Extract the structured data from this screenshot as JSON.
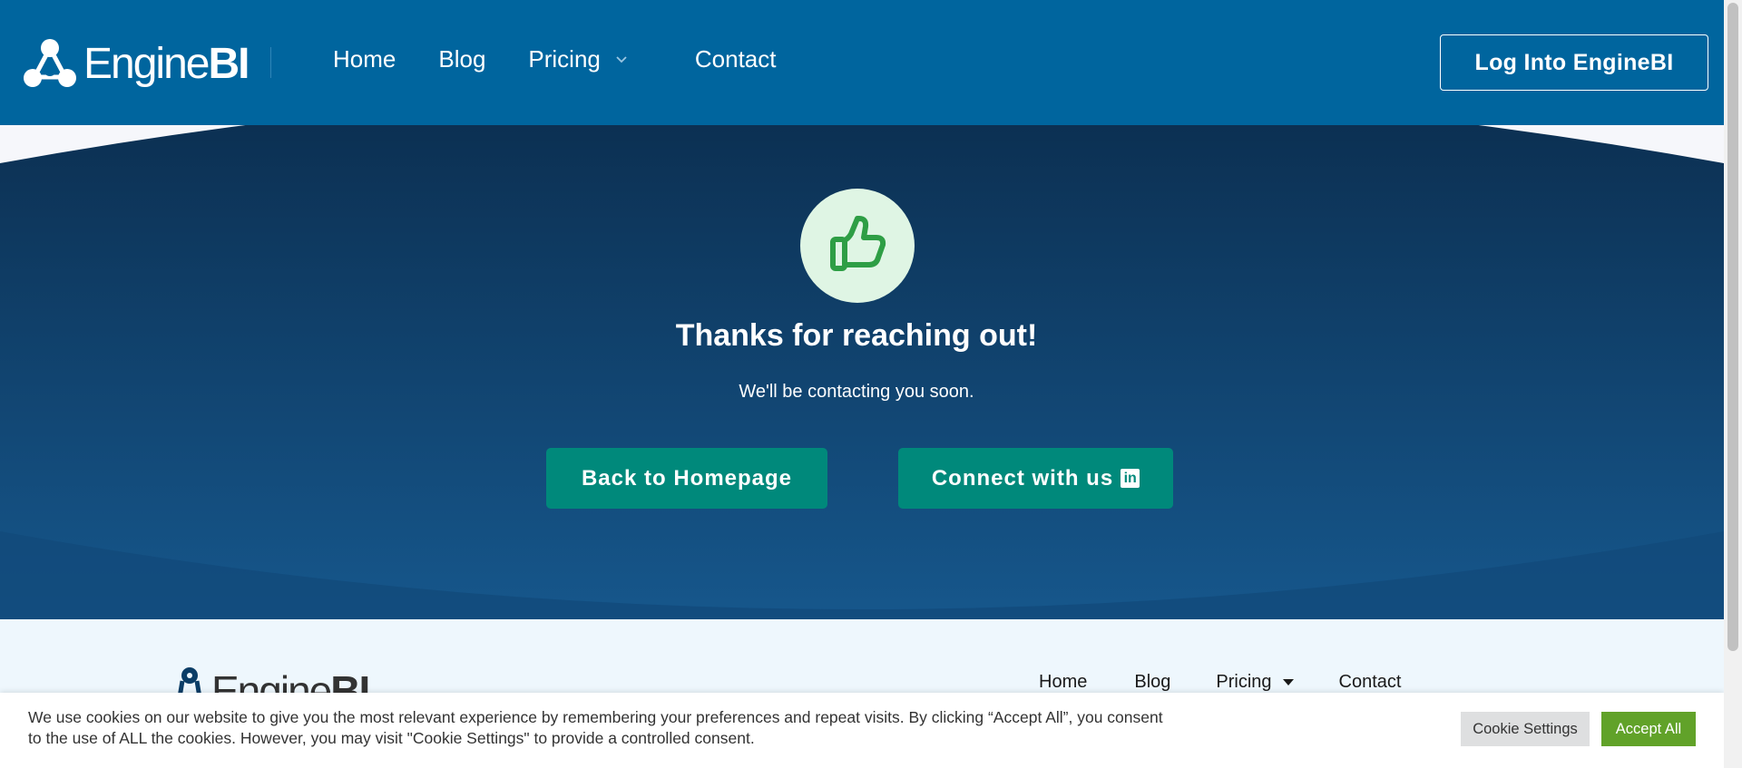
{
  "header": {
    "logo_light": "Engine",
    "logo_bold": "BI",
    "nav": {
      "home": "Home",
      "blog": "Blog",
      "pricing": "Pricing",
      "contact": "Contact"
    },
    "login_label": "Log Into EngineBI"
  },
  "hero": {
    "title": "Thanks for reaching out!",
    "subtitle": "We'll be contacting you soon.",
    "back_label": "Back to Homepage",
    "connect_label": "Connect with us",
    "linkedin_glyph": "in",
    "icon": "thumbs-up-icon"
  },
  "footer": {
    "logo_light": "Engine",
    "logo_bold": "BI",
    "nav": {
      "home": "Home",
      "blog": "Blog",
      "pricing": "Pricing",
      "contact": "Contact"
    }
  },
  "cookie": {
    "text": "We use cookies on our website to give you the most relevant experience by remembering your preferences and repeat visits. By clicking “Accept All”, you consent to the use of ALL the cookies. However, you may visit \"Cookie Settings\" to provide a controlled consent.",
    "settings_label": "Cookie Settings",
    "accept_label": "Accept All"
  },
  "colors": {
    "header_bg": "#00659e",
    "hero_dark": "#0b2d4e",
    "hero_light": "#15558a",
    "cta_bg": "#00897b",
    "thumb_circle": "#dff5e4",
    "thumb_icon": "#2e9e45",
    "accept_bg": "#61a229",
    "footer_bg": "#eef7fd"
  }
}
